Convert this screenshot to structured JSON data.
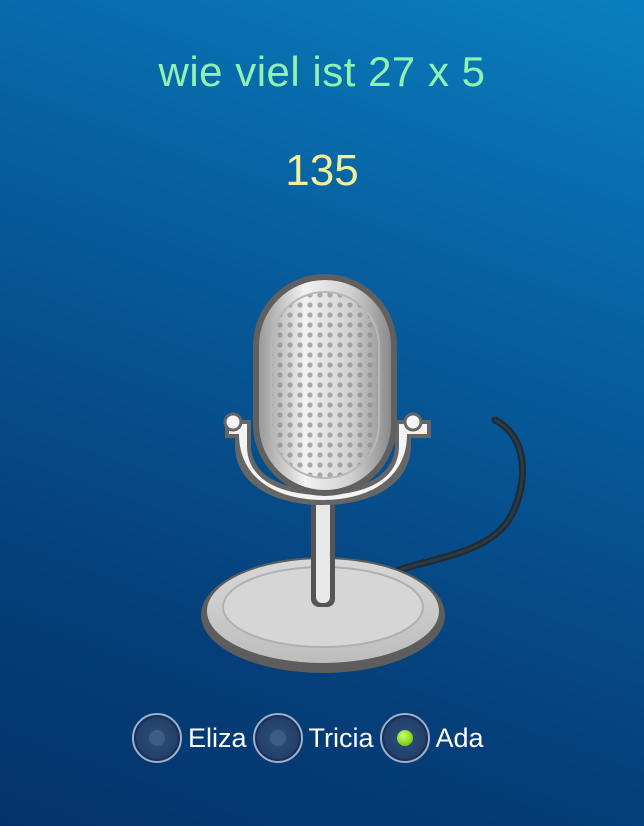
{
  "question": "wie viel ist 27 x 5",
  "answer": "135",
  "microphone": {
    "icon": "microphone-icon"
  },
  "voices": {
    "options": [
      {
        "label": "Eliza",
        "selected": false
      },
      {
        "label": "Tricia",
        "selected": false
      },
      {
        "label": "Ada",
        "selected": true
      }
    ]
  },
  "colors": {
    "question": "#8ff2b0",
    "answer": "#f4f09a",
    "selected_radio": "#86d61f"
  }
}
